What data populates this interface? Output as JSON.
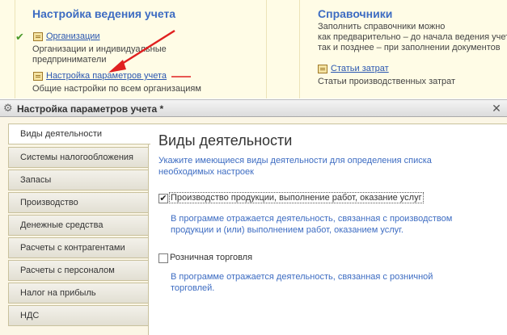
{
  "help": {
    "accounting": {
      "title": "Настройка ведения учета",
      "org_link": "Организации",
      "org_desc_1": "Организации и индивидуальные",
      "org_desc_2": "предприниматели",
      "params_link": "Настройка параметров учета",
      "params_desc": "Общие настройки по всем организациям"
    },
    "references": {
      "title": "Справочники",
      "desc_1": "Заполнить справочники можно",
      "desc_2": "как предварительно – до начала ведения учет",
      "desc_3": "так и позднее – при заполнении документов",
      "costs_link": "Статьи затрат",
      "costs_desc": "Статьи производственных затрат"
    }
  },
  "window": {
    "title": "Настройка параметров учета *",
    "close_glyph": "✕"
  },
  "tabs": [
    {
      "label": "Виды деятельности",
      "active": true
    },
    {
      "label": "Системы налогообложения",
      "active": false
    },
    {
      "label": "Запасы",
      "active": false
    },
    {
      "label": "Производство",
      "active": false
    },
    {
      "label": "Денежные средства",
      "active": false
    },
    {
      "label": "Расчеты с контрагентами",
      "active": false
    },
    {
      "label": "Расчеты с персоналом",
      "active": false
    },
    {
      "label": "Налог на прибыль",
      "active": false
    },
    {
      "label": "НДС",
      "active": false
    }
  ],
  "panel": {
    "title": "Виды деятельности",
    "intro_1": "Укажите имеющиеся виды деятельности для определения списка",
    "intro_2": "необходимых настроек",
    "production": {
      "checked": true,
      "check_glyph": "✔",
      "label": "Производство продукции, выполнение работ, оказание услуг",
      "desc_1": "В программе отражается деятельность, связанная с производством",
      "desc_2": "продукции и (или) выполнением работ, оказанием услуг."
    },
    "retail": {
      "checked": false,
      "label": "Розничная торговля",
      "desc_1": "В программе отражается деятельность, связанная с розничной",
      "desc_2": "торговлей."
    }
  },
  "colors": {
    "accent_blue": "#3d6cc2",
    "link_blue": "#2b57b0",
    "help_bg": "#fffce6",
    "form_bg": "#fbf6e6",
    "annotation_red": "#e02020"
  }
}
